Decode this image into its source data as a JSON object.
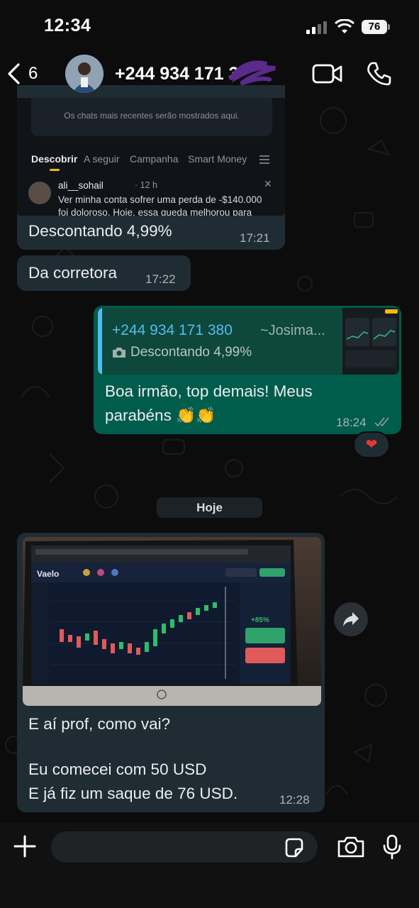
{
  "status_bar": {
    "time": "12:34",
    "battery": "76"
  },
  "header": {
    "back_count": "6",
    "contact_name": "+244 934 171 3"
  },
  "messages": {
    "m1": {
      "screenshot": {
        "recent_chats": "Os chats mais recentes serão mostrados aqui.",
        "tabs": [
          "Descobrir",
          "A seguir",
          "Campanha",
          "Smart Money"
        ],
        "post_user": "ali__sohail",
        "post_time": "· 12 h",
        "post_lines": [
          "Ver minha conta sofrer uma perda de -$140.000",
          "foi doloroso. Hoje, essa queda melhorou para"
        ]
      },
      "text": "Descontando 4,99%",
      "time": "17:21"
    },
    "m2": {
      "text": "Da corretora",
      "time": "17:22"
    },
    "m3": {
      "quote_name": "+244 934 171 380",
      "quote_alias": "~Josima...",
      "quote_body": "Descontando 4,99%",
      "line1": "Boa irmão, top demais! Meus",
      "line2": "parabéns 👏👏",
      "time": "18:24",
      "reaction": "❤"
    },
    "date_divider": "Hoje",
    "m4": {
      "lines": [
        "E aí prof, como vai?",
        "",
        "Eu comecei com 50 USD",
        "E já fiz um saque de 76 USD."
      ],
      "time": "12:28"
    }
  },
  "composer": {
    "placeholder": ""
  },
  "colors": {
    "incoming": "#202c33",
    "outgoing": "#005c4b",
    "link_blue": "#53bdeb",
    "read_ticks": "#8696a0"
  },
  "icons": [
    "chevron-left-icon",
    "video-call-icon",
    "phone-icon",
    "camera-icon",
    "forward-icon",
    "plus-icon",
    "sticker-icon",
    "microphone-icon"
  ]
}
